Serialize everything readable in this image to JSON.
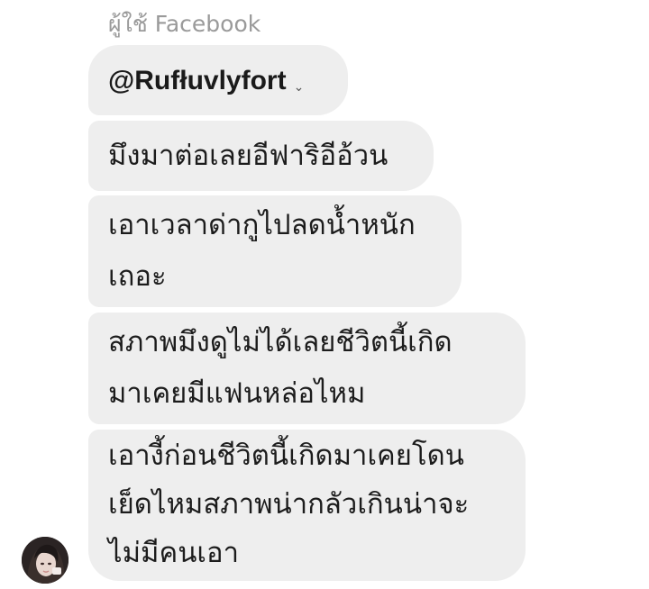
{
  "thread": {
    "sender_label": "ผู้ใช้ Facebook",
    "mention_mark": "⌄",
    "messages": [
      {
        "lines": [
          "@Rufłuvlyfort"
        ]
      },
      {
        "lines": [
          "มึงมาต่อเลยอีฟาริอีอ้วน"
        ]
      },
      {
        "lines": [
          "เอาเวลาด่ากูไปลดน้ำหนัก",
          "เถอะ"
        ]
      },
      {
        "lines": [
          "สภาพมึงดูไม่ได้เลยชีวิตนี้เกิด",
          "มาเคยมีแฟนหล่อไหม"
        ]
      },
      {
        "lines": [
          "เอางี้ก่อนชีวิตนี้เกิดมาเคยโดน",
          "เย็ดไหมสภาพน่ากลัวเกินน่าจะ",
          "ไม่มีคนเอา"
        ]
      }
    ]
  },
  "colors": {
    "bubble_background": "#eeeeee",
    "message_text": "#1c1c1c",
    "sender_label": "#9a9a9a"
  },
  "icons": {
    "avatar": "profile-photo"
  }
}
